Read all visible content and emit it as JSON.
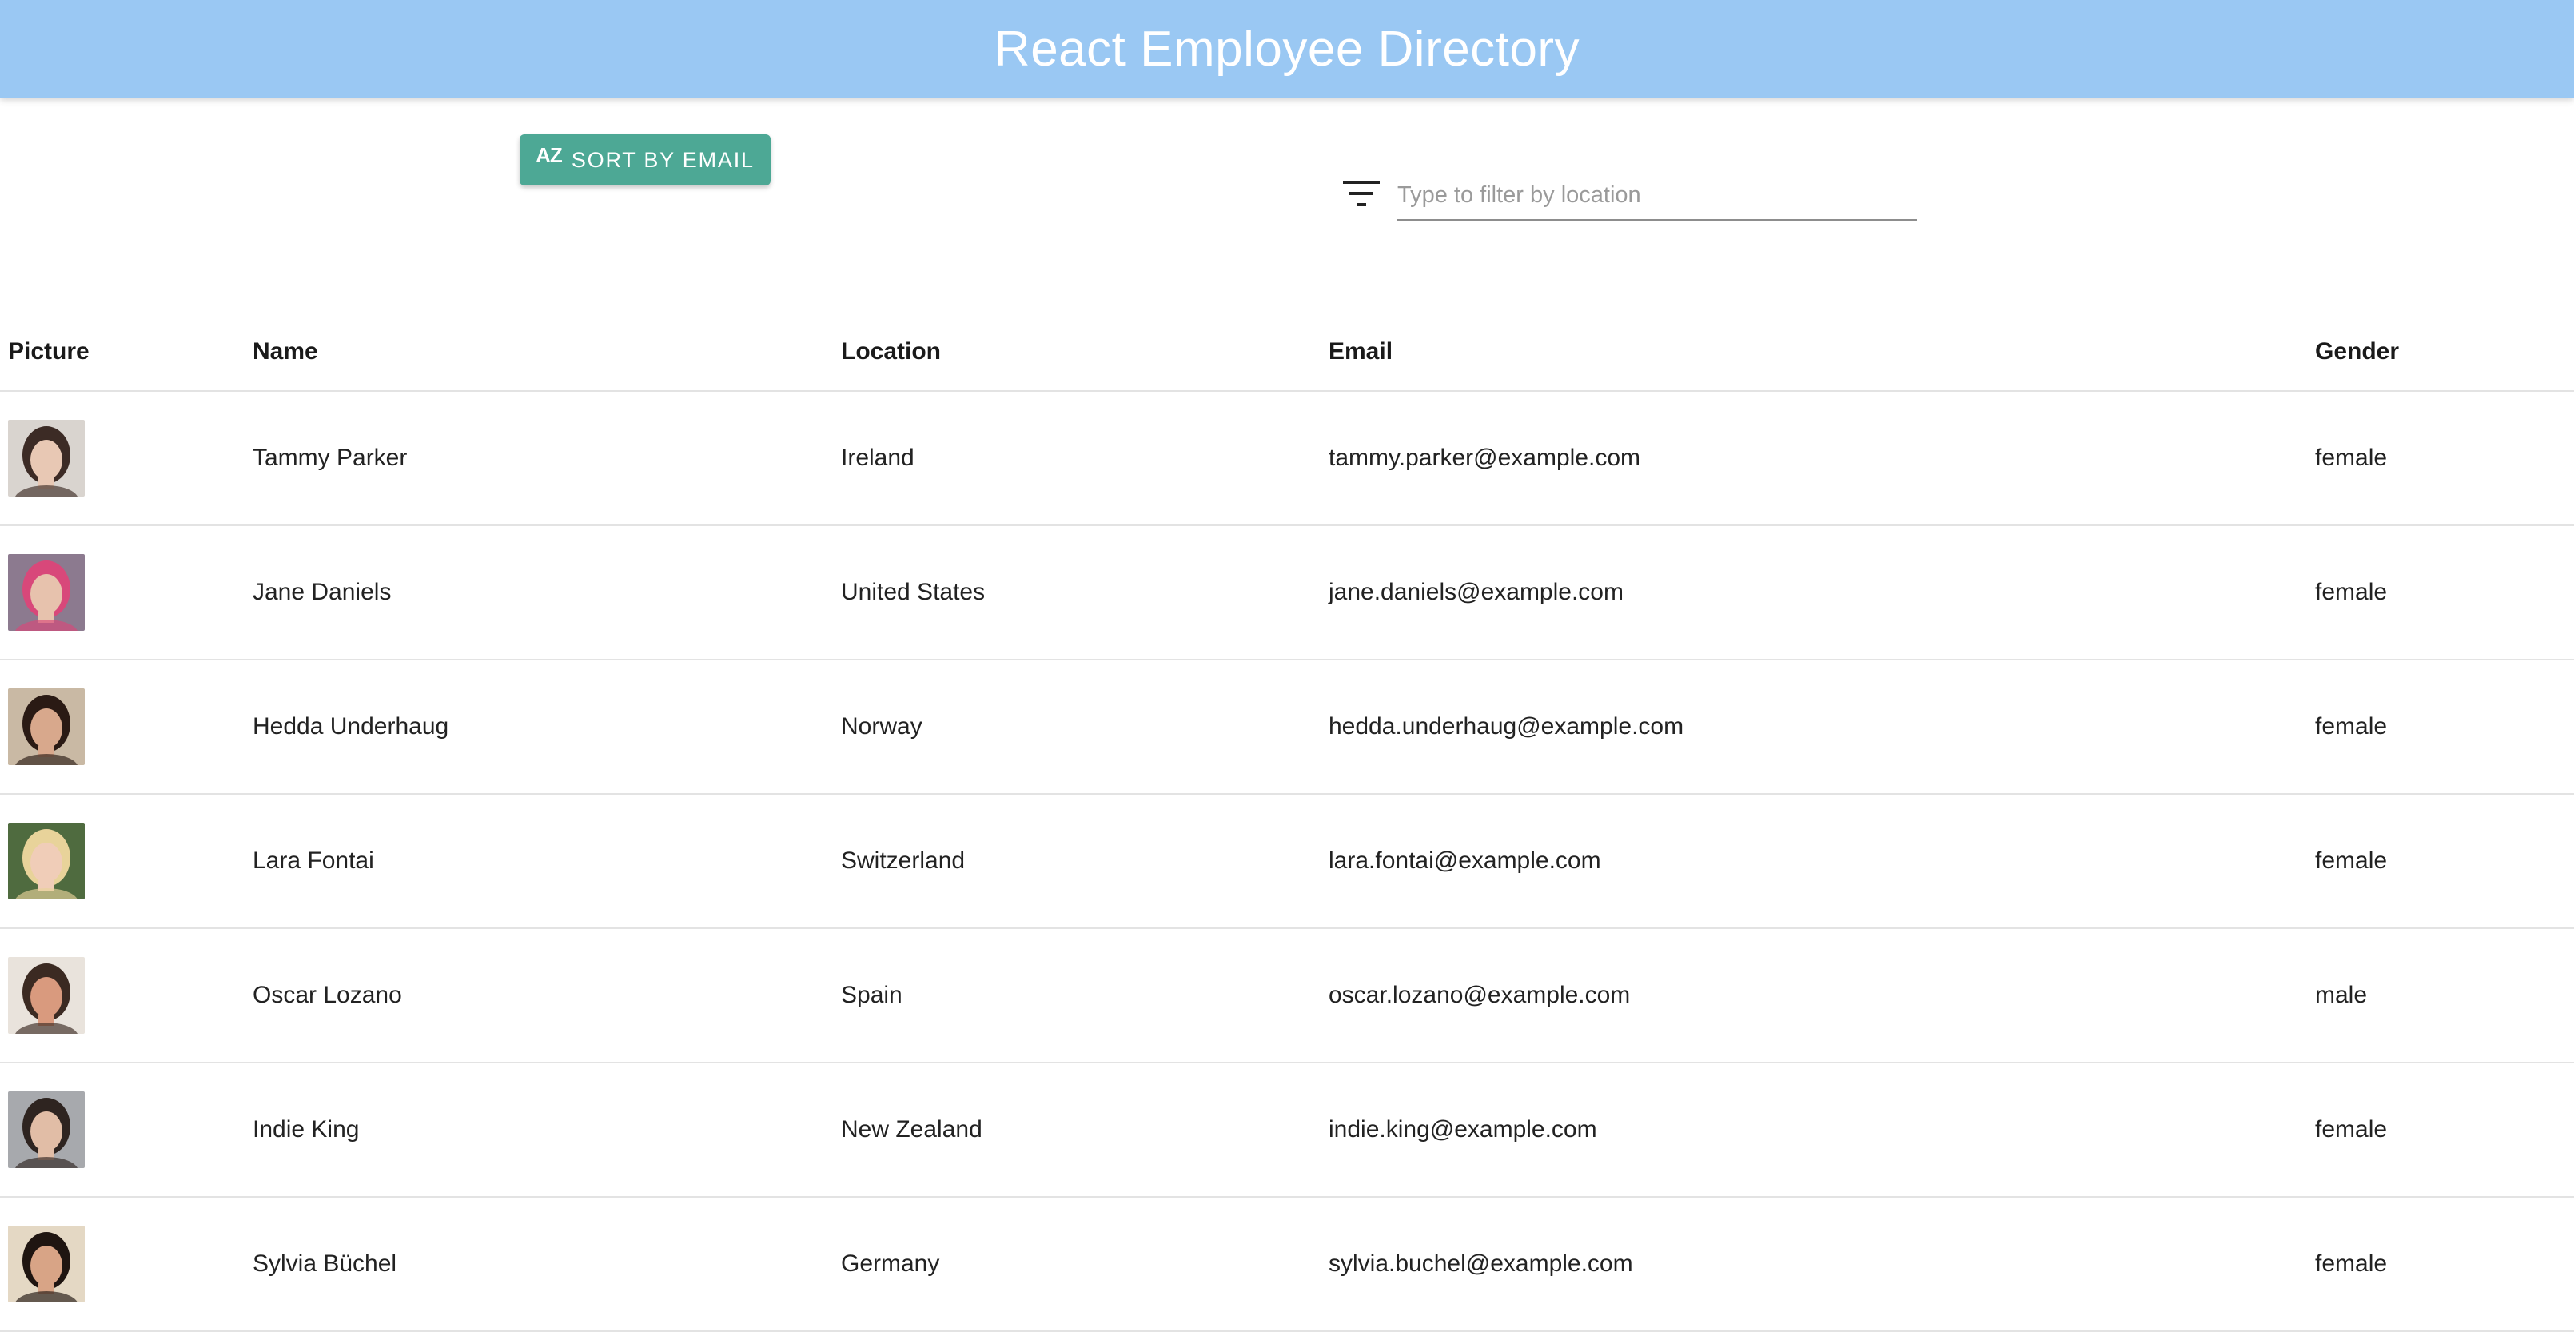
{
  "app": {
    "title": "React Employee Directory"
  },
  "toolbar": {
    "sort_icon": "AZ",
    "sort_label": "SORT BY EMAIL",
    "filter_placeholder": "Type to filter by location",
    "filter_value": ""
  },
  "table": {
    "columns": [
      "Picture",
      "Name",
      "Location",
      "Email",
      "Gender"
    ],
    "rows": [
      {
        "name": "Tammy Parker",
        "location": "Ireland",
        "email": "tammy.parker@example.com",
        "gender": "female",
        "avatar": {
          "bg": "#d9d4cf",
          "skin": "#e8c8b4",
          "hair": "#3c2b25"
        }
      },
      {
        "name": "Jane Daniels",
        "location": "United States",
        "email": "jane.daniels@example.com",
        "gender": "female",
        "avatar": {
          "bg": "#8c7a8f",
          "skin": "#e7c2ad",
          "hair": "#d8487a"
        }
      },
      {
        "name": "Hedda Underhaug",
        "location": "Norway",
        "email": "hedda.underhaug@example.com",
        "gender": "female",
        "avatar": {
          "bg": "#c9b9a4",
          "skin": "#d8a88c",
          "hair": "#2a1a14"
        }
      },
      {
        "name": "Lara Fontai",
        "location": "Switzerland",
        "email": "lara.fontai@example.com",
        "gender": "female",
        "avatar": {
          "bg": "#4f6b3f",
          "skin": "#f0cdb8",
          "hair": "#e8d39a"
        }
      },
      {
        "name": "Oscar Lozano",
        "location": "Spain",
        "email": "oscar.lozano@example.com",
        "gender": "male",
        "avatar": {
          "bg": "#e9e3dc",
          "skin": "#d99a7e",
          "hair": "#3b2a22"
        }
      },
      {
        "name": "Indie King",
        "location": "New Zealand",
        "email": "indie.king@example.com",
        "gender": "female",
        "avatar": {
          "bg": "#a7a9ad",
          "skin": "#e1bda6",
          "hair": "#2e2420"
        }
      },
      {
        "name": "Sylvia Büchel",
        "location": "Germany",
        "email": "sylvia.buchel@example.com",
        "gender": "female",
        "avatar": {
          "bg": "#e4d8c4",
          "skin": "#d8a486",
          "hair": "#1f1511"
        }
      }
    ]
  },
  "colors": {
    "header_bg": "#9ac8f3",
    "button_bg": "#4da895",
    "divider": "#e3e3e3"
  },
  "icons": {
    "sort": "sort-alpha-icon",
    "filter": "filter-list-icon"
  }
}
